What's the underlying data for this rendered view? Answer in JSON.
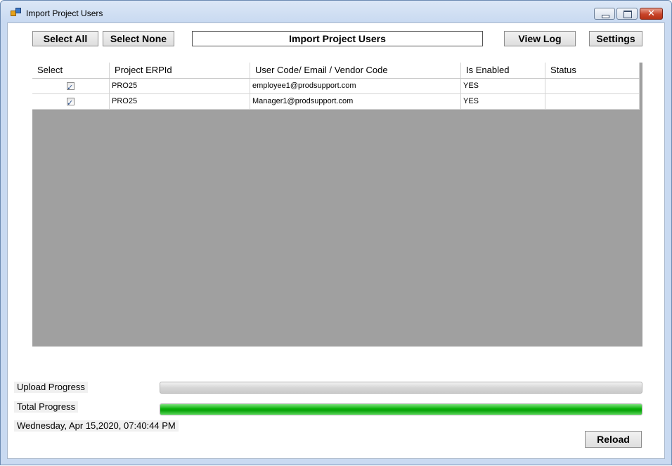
{
  "window": {
    "title": "Import Project Users",
    "controls": {
      "minimize": "minimize",
      "maximize": "maximize",
      "close": "✕"
    }
  },
  "toolbar": {
    "select_all": "Select All",
    "select_none": "Select None",
    "import": "Import Project Users",
    "view_log": "View Log",
    "settings": "Settings"
  },
  "grid": {
    "columns": [
      "Select",
      "Project ERPId",
      "User Code/ Email / Vendor Code",
      "Is Enabled",
      "Status"
    ],
    "rows": [
      {
        "selected": true,
        "project": "PRO25",
        "user": "employee1@prodsupport.com",
        "enabled": "YES",
        "status": ""
      },
      {
        "selected": true,
        "project": "PRO25",
        "user": "Manager1@prodsupport.com",
        "enabled": "YES",
        "status": ""
      }
    ]
  },
  "progress": {
    "upload_label": "Upload Progress",
    "upload_value": 0,
    "total_label": "Total Progress",
    "total_value": 100
  },
  "timestamp": "Wednesday, Apr 15,2020, 07:40:44 PM",
  "reload": "Reload",
  "colors": {
    "progress_fill": "#06b006",
    "grid_background": "#a0a0a0"
  },
  "icons": {
    "app": "app-window-icon",
    "checkbox": "checkmark-icon"
  }
}
